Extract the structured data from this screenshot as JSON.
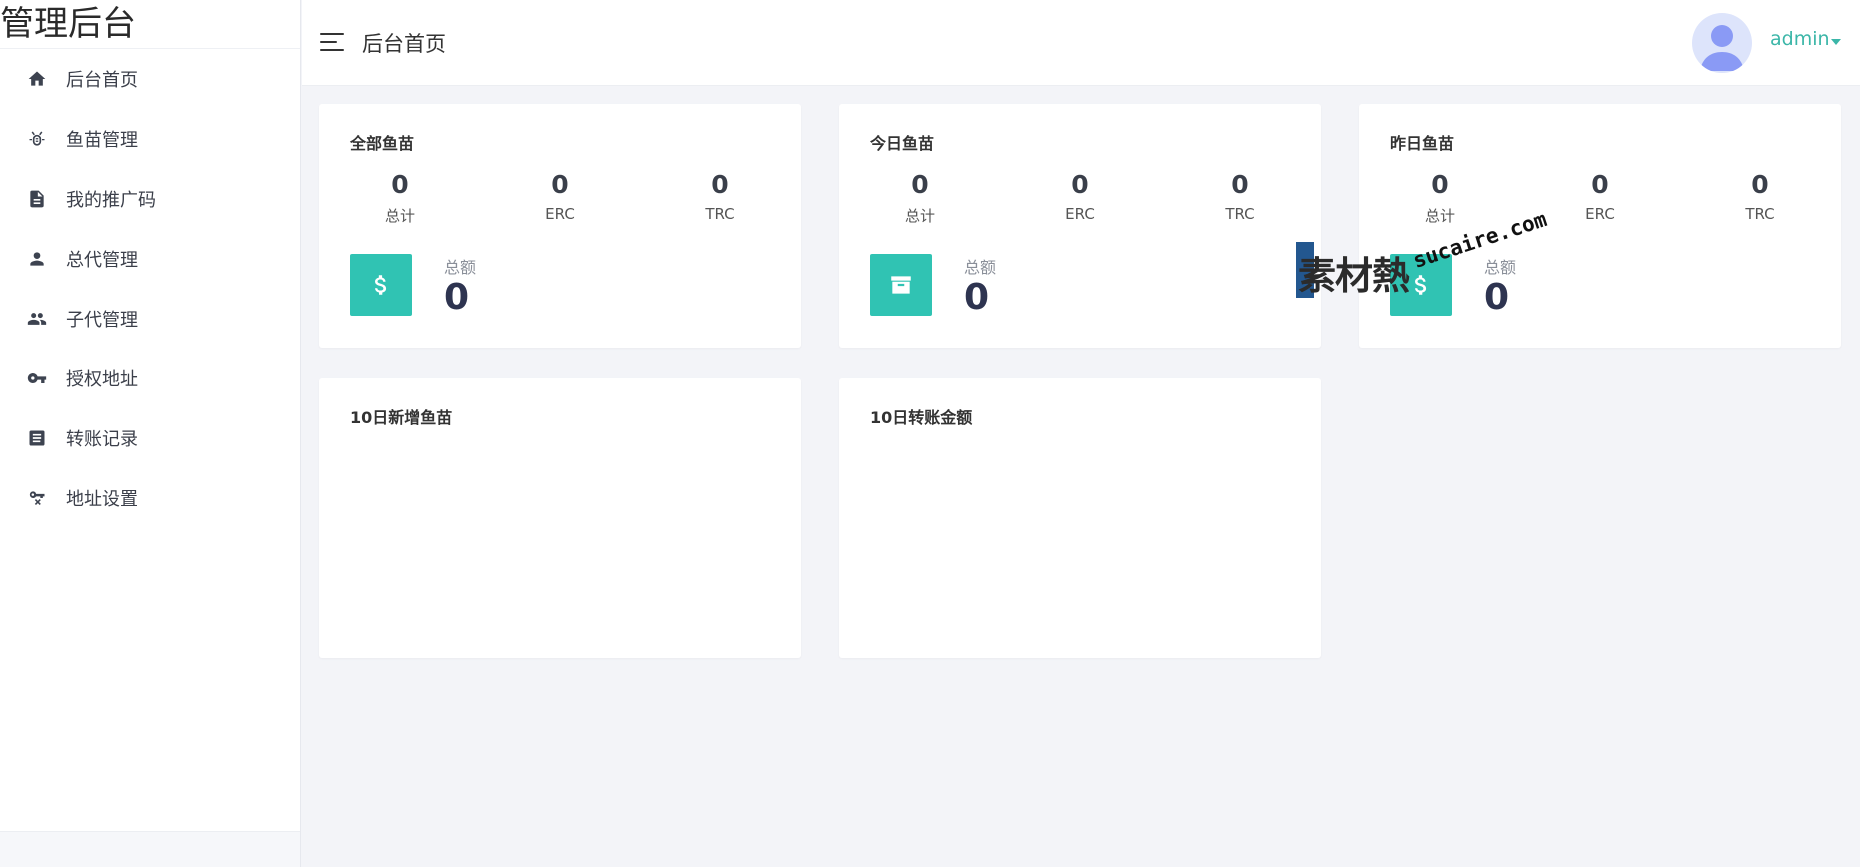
{
  "app": {
    "brand": "管理后台"
  },
  "sidebar": {
    "items": [
      {
        "label": "后台首页",
        "icon": "home-icon"
      },
      {
        "label": "鱼苗管理",
        "icon": "bug-icon"
      },
      {
        "label": "我的推广码",
        "icon": "document-icon"
      },
      {
        "label": "总代管理",
        "icon": "person-icon"
      },
      {
        "label": "子代管理",
        "icon": "people-icon"
      },
      {
        "label": "授权地址",
        "icon": "key-icon"
      },
      {
        "label": "转账记录",
        "icon": "list-icon"
      },
      {
        "label": "地址设置",
        "icon": "key-settings-icon"
      }
    ]
  },
  "header": {
    "menu_icon": "hamburger-icon",
    "title": "后台首页",
    "user": "admin",
    "avatar_icon": "user-avatar-icon"
  },
  "stats": [
    {
      "title": "全部鱼苗",
      "metrics": [
        {
          "value": "0",
          "label": "总计"
        },
        {
          "value": "0",
          "label": "ERC"
        },
        {
          "value": "0",
          "label": "TRC"
        }
      ],
      "total_label": "总额",
      "total_value": "0",
      "icon": "dollar-icon"
    },
    {
      "title": "今日鱼苗",
      "metrics": [
        {
          "value": "0",
          "label": "总计"
        },
        {
          "value": "0",
          "label": "ERC"
        },
        {
          "value": "0",
          "label": "TRC"
        }
      ],
      "total_label": "总额",
      "total_value": "0",
      "icon": "archive-icon"
    },
    {
      "title": "昨日鱼苗",
      "metrics": [
        {
          "value": "0",
          "label": "总计"
        },
        {
          "value": "0",
          "label": "ERC"
        },
        {
          "value": "0",
          "label": "TRC"
        }
      ],
      "total_label": "总额",
      "total_value": "0",
      "icon": "dollar-icon"
    }
  ],
  "charts": [
    {
      "title": "10日新增鱼苗"
    },
    {
      "title": "10日转账金额"
    }
  ],
  "watermark": {
    "text_cn": "素材熱",
    "text_en": "sucaire.com"
  },
  "colors": {
    "accent": "#30c3b3",
    "user_link": "#3bb6a8",
    "background": "#f3f4f8",
    "value_dark": "#2e3450"
  }
}
